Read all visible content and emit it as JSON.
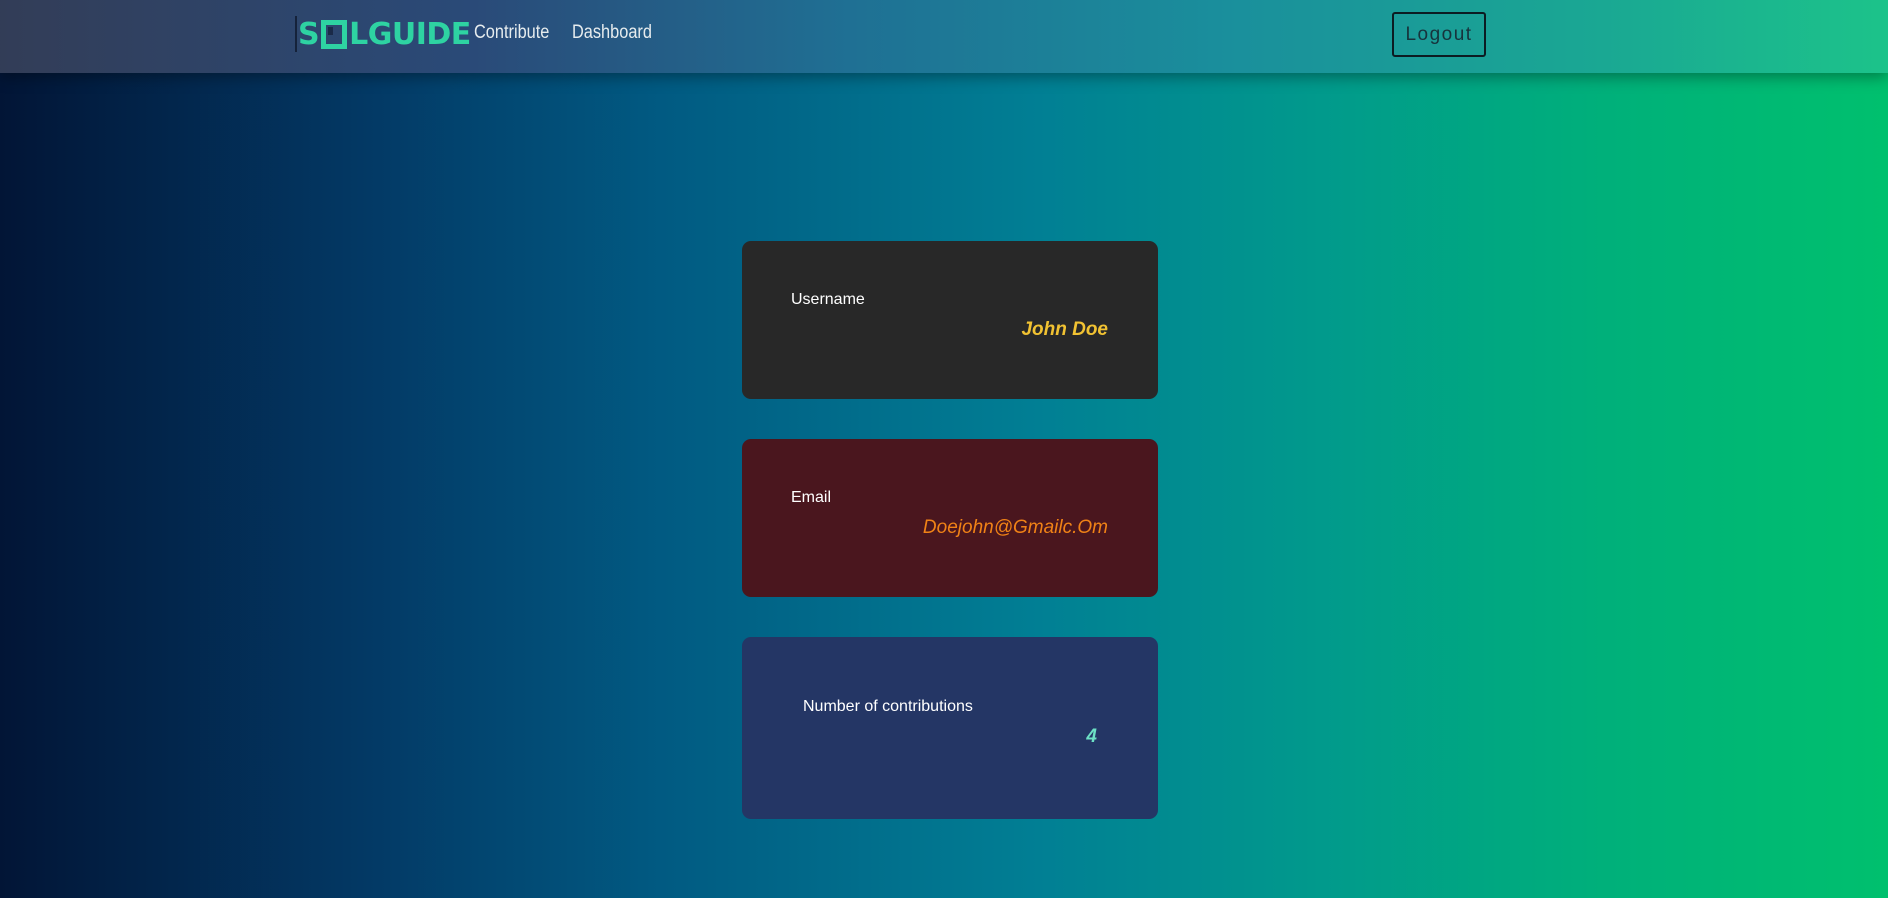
{
  "header": {
    "logo_left": "S",
    "logo_right": "LGUIDE",
    "nav": {
      "contribute": "Contribute",
      "dashboard": "Dashboard"
    },
    "logout_label": "Logout"
  },
  "profile": {
    "username": {
      "label": "Username",
      "value": "John Doe"
    },
    "email": {
      "label": "Email",
      "value": "Doejohn@Gmailc.Om"
    },
    "contributions": {
      "label": "Number of contributions",
      "value": "4"
    }
  },
  "colors": {
    "logo": "#2ed3a2",
    "username_card": "#282828",
    "username_value": "#f1c232",
    "email_card": "#4a161e",
    "email_value": "#f08216",
    "contrib_card": "#243665",
    "contrib_value": "#6ce0c4"
  }
}
